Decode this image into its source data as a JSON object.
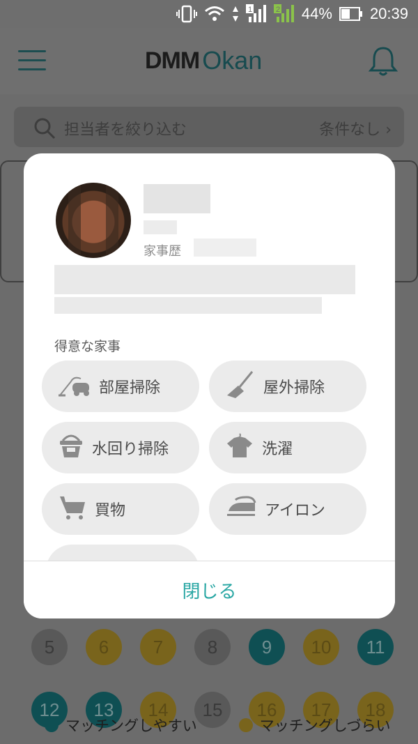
{
  "status_bar": {
    "battery_percent": "44%",
    "time": "20:39",
    "sim_badges": [
      "1",
      "2"
    ]
  },
  "app_bar": {
    "logo_dmm": "DMM",
    "logo_okan": "Okan"
  },
  "search": {
    "placeholder": "担当者を絞り込む",
    "condition": "条件なし"
  },
  "modal": {
    "history_label": "家事歴",
    "section_title": "得意な家事",
    "chores": [
      {
        "label": "部屋掃除",
        "icon": "vacuum-icon"
      },
      {
        "label": "屋外掃除",
        "icon": "broom-icon"
      },
      {
        "label": "水回り掃除",
        "icon": "bucket-icon"
      },
      {
        "label": "洗濯",
        "icon": "shirt-icon"
      },
      {
        "label": "買物",
        "icon": "cart-icon"
      },
      {
        "label": "アイロン",
        "icon": "iron-icon"
      }
    ],
    "close_label": "閉じる"
  },
  "calendar": {
    "row1": [
      {
        "day": "5",
        "status": "gray"
      },
      {
        "day": "6",
        "status": "gold"
      },
      {
        "day": "7",
        "status": "gold"
      },
      {
        "day": "8",
        "status": "gray"
      },
      {
        "day": "9",
        "status": "teal"
      },
      {
        "day": "10",
        "status": "gold"
      },
      {
        "day": "11",
        "status": "teal"
      }
    ],
    "row2": [
      {
        "day": "12",
        "status": "teal"
      },
      {
        "day": "13",
        "status": "teal"
      },
      {
        "day": "14",
        "status": "gold"
      },
      {
        "day": "15",
        "status": "gray"
      },
      {
        "day": "16",
        "status": "gold"
      },
      {
        "day": "17",
        "status": "gold"
      },
      {
        "day": "18",
        "status": "gold"
      }
    ]
  },
  "legend": {
    "easy": "マッチングしやすい",
    "hard": "マッチングしづらい"
  },
  "colors": {
    "accent": "#2aa7a4",
    "chip_bg": "#ebebeb",
    "teal_day": "#0f4f53",
    "gold_day": "#79641c"
  }
}
